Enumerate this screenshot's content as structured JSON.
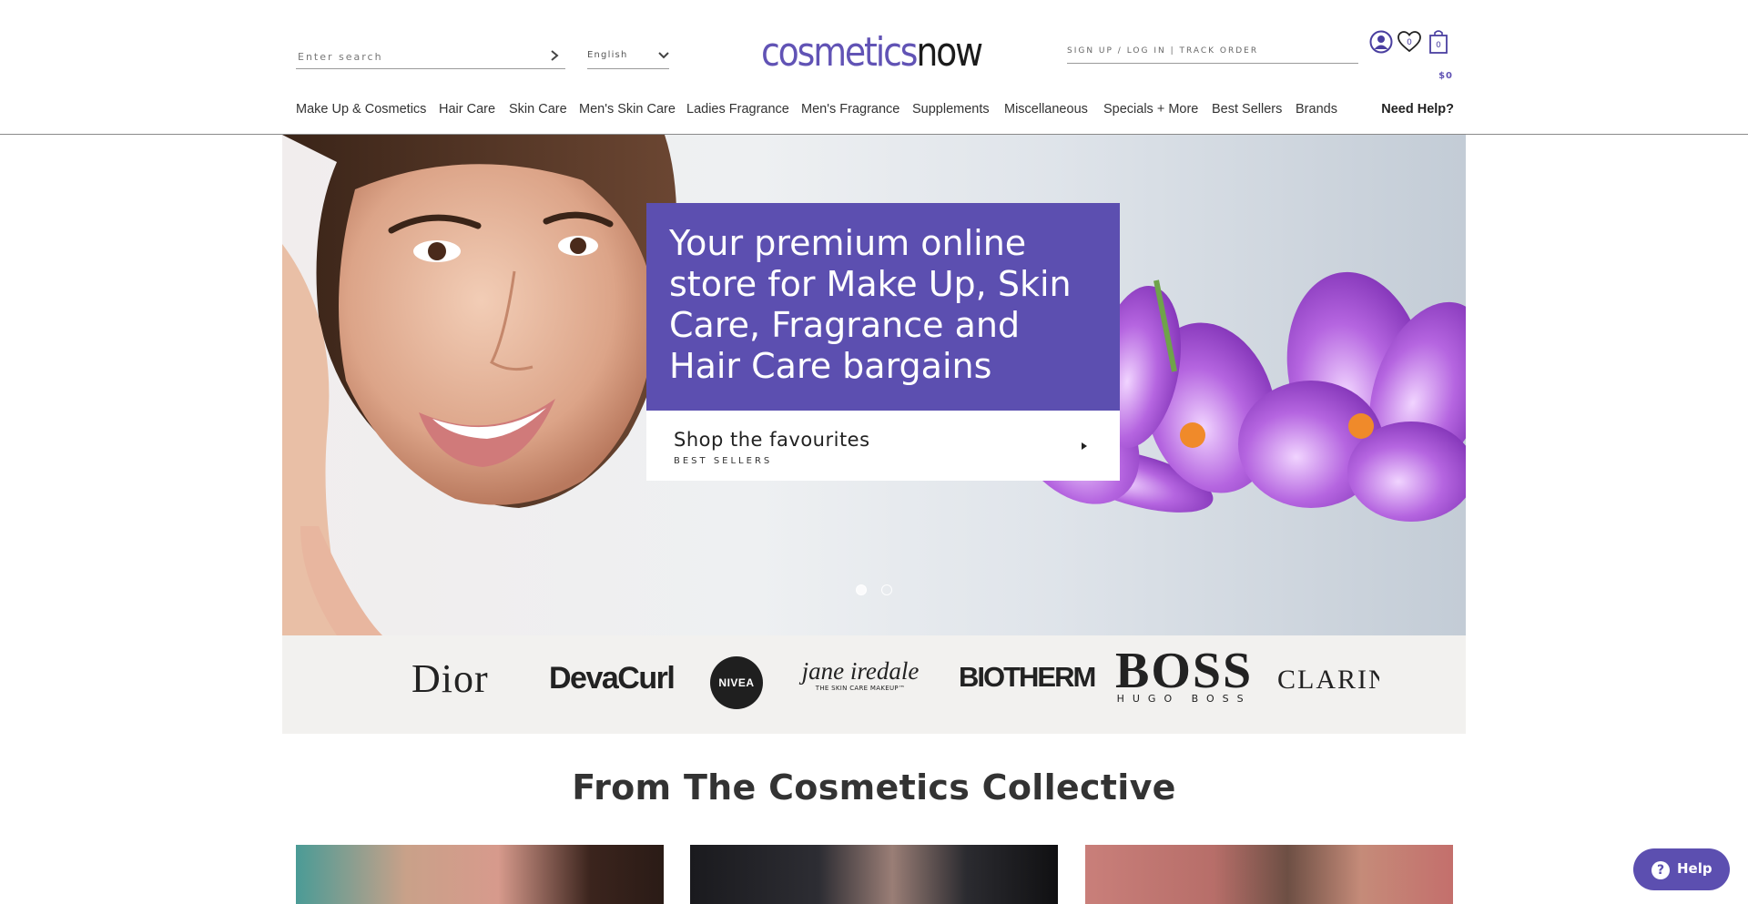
{
  "header": {
    "search": {
      "placeholder": "Enter search",
      "value": ""
    },
    "language": {
      "selected": "English"
    },
    "logo": {
      "part1": "cosmetics",
      "part2": "now"
    },
    "account_links": "SIGN UP / LOG IN | TRACK ORDER",
    "wishlist_count": "0",
    "cart_count": "0",
    "cart_total": "$0"
  },
  "nav": {
    "items": [
      {
        "label": "Make Up & Cosmetics"
      },
      {
        "label": "Hair Care"
      },
      {
        "label": "Skin Care"
      },
      {
        "label": "Men's Skin Care"
      },
      {
        "label": "Ladies Fragrance"
      },
      {
        "label": "Men's Fragrance"
      },
      {
        "label": "Supplements"
      },
      {
        "label": "Miscellaneous"
      },
      {
        "label": "Specials + More"
      },
      {
        "label": "Best Sellers"
      },
      {
        "label": "Brands"
      }
    ],
    "help_label": "Need Help?"
  },
  "hero": {
    "title_strong": "Your premium online store",
    "title_rest": "for Make Up, Skin Care, Fragrance and Hair Care bargains",
    "cta_title": "Shop the favourites",
    "cta_subtitle": "BEST SELLERS",
    "slides_total": 2,
    "active_slide": 1
  },
  "brands": {
    "dior": "Dior",
    "devacurl": "DevaCurl",
    "nivea": "NIVEA",
    "jane_iredale": "jane iredale",
    "jane_iredale_tag": "THE SKIN CARE MAKEUP™",
    "biotherm": "BIOTHERM",
    "boss": "BOSS",
    "boss_tag": "HUGO BOSS",
    "clarins": "CLARINS"
  },
  "collective": {
    "title": "From The Cosmetics Collective"
  },
  "help_widget": {
    "label": "Help",
    "icon": "question-icon"
  },
  "colors": {
    "brand_purple": "#5c4fb0",
    "logo_purple": "#6153b5",
    "brand_strip_bg": "#f2f1ef"
  }
}
